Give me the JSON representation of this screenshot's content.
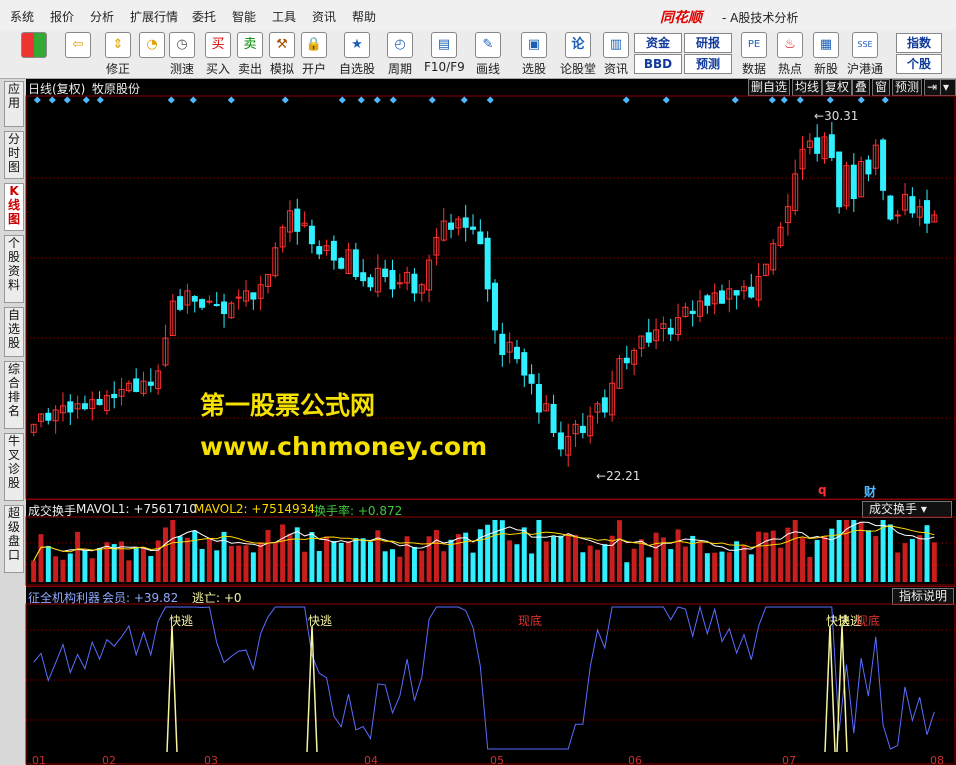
{
  "menubar": {
    "items": [
      "系统",
      "报价",
      "分析",
      "扩展行情",
      "委托",
      "智能",
      "工具",
      "资讯",
      "帮助"
    ],
    "brand": "同花顺",
    "brand_sub": "- A股技术分析"
  },
  "toolbar": {
    "buttons": [
      {
        "label": "",
        "icon": "home-icon"
      },
      {
        "label": "",
        "icon": "back-arrow-icon"
      },
      {
        "label": "修正",
        "icon": "up-down-arrow-icon"
      },
      {
        "label": "测速",
        "icon": "clock-icon"
      },
      {
        "label": "买入",
        "icon": "buy-icon"
      },
      {
        "label": "卖出",
        "icon": "sell-icon"
      },
      {
        "label": "模拟",
        "icon": "hammer-icon"
      },
      {
        "label": "开户",
        "icon": "lock-icon"
      },
      {
        "label": "自选股",
        "icon": "star-icon"
      },
      {
        "label": "周期",
        "icon": "period-icon"
      },
      {
        "label": "F10/F9",
        "icon": "f10-icon"
      },
      {
        "label": "画线",
        "icon": "pen-icon"
      },
      {
        "label": "选股",
        "icon": "select-icon"
      },
      {
        "label": "论股堂",
        "icon": "forum-icon"
      },
      {
        "label": "资讯",
        "icon": "news-icon"
      },
      {
        "label": "数据",
        "icon": "pe-icon"
      },
      {
        "label": "热点",
        "icon": "hot-icon"
      },
      {
        "label": "新股",
        "icon": "newstock-icon"
      },
      {
        "label": "沪港通",
        "icon": "sse-hk-icon"
      }
    ],
    "small_buttons": [
      "资金",
      "研报",
      "BBD",
      "预测",
      "指数",
      "个股"
    ]
  },
  "sidetabs": [
    "应用",
    "分时图",
    "K线图",
    "个股资料",
    "自选股",
    "综合排名",
    "牛叉诊股",
    "超级盘口"
  ],
  "active_tab": "K线图",
  "kline": {
    "title": "日线(复权)",
    "stock": "牧原股份",
    "toolbar_buttons": [
      "删自选",
      "均线",
      "复权",
      "叠",
      "窗",
      "预测"
    ],
    "high_label": "30.31",
    "low_label": "22.21",
    "markers": [
      "q",
      "财"
    ]
  },
  "volume": {
    "title": "成交换手",
    "mavol1": "MAVOL1: +7561710",
    "mavol2": "MAVOL2: +7514934",
    "turnover": "换手率: +0.872",
    "button": "成交换手"
  },
  "indicator": {
    "title": "征全机构利器",
    "member": "会员: +39.82",
    "escape": "逃亡: +0",
    "button": "指标说明",
    "labels": [
      {
        "text": "快逃",
        "color": "#f5f5a0"
      },
      {
        "text": "快逃",
        "color": "#f5f5a0"
      },
      {
        "text": "现底",
        "color": "#e03030"
      },
      {
        "text": "快逃",
        "color": "#f5f5a0"
      },
      {
        "text": "快逃",
        "color": "#f5f5a0"
      },
      {
        "text": "现底",
        "color": "#e03030"
      }
    ]
  },
  "watermark": {
    "line1": "第一股票公式网",
    "line2": "www.chnmoney.com"
  },
  "colors": {
    "up": "#ff3030",
    "down": "#30f0ff",
    "grid": "#8a0000",
    "diamond": "#4fb8ff",
    "ma": "#ffffff",
    "line": "#5a6dff",
    "spike": "#f5f5a0"
  },
  "chart_data": {
    "type": "candlestick",
    "x_ticks": [
      "01",
      "02",
      "03",
      "04",
      "05",
      "06",
      "07",
      "08"
    ],
    "price_range": [
      21.5,
      31
    ],
    "closes": [
      23.1,
      23.35,
      23.2,
      23.45,
      23.55,
      23.4,
      23.6,
      23.48,
      23.7,
      23.58,
      23.8,
      23.75,
      23.95,
      24.1,
      23.9,
      24.15,
      24.05,
      24.4,
      25.2,
      26.1,
      25.9,
      26.35,
      26.1,
      25.95,
      26.1,
      26.0,
      25.8,
      26.05,
      26.2,
      26.35,
      26.15,
      26.5,
      26.75,
      27.4,
      27.9,
      28.3,
      27.8,
      28.0,
      27.5,
      27.25,
      27.45,
      27.1,
      26.9,
      27.35,
      26.7,
      26.6,
      26.45,
      26.9,
      26.7,
      26.4,
      26.55,
      26.8,
      26.3,
      26.5,
      27.1,
      27.65,
      28.05,
      27.85,
      28.1,
      27.9,
      27.85,
      27.5,
      26.4,
      25.4,
      24.8,
      25.1,
      24.7,
      24.3,
      24.1,
      23.4,
      23.6,
      22.9,
      22.5,
      22.8,
      23.1,
      22.9,
      23.3,
      23.6,
      23.4,
      24.1,
      24.7,
      24.6,
      24.9,
      25.25,
      25.1,
      25.4,
      25.55,
      25.3,
      25.7,
      25.95,
      25.8,
      26.1,
      26.0,
      26.3,
      26.05,
      26.4,
      26.25,
      26.45,
      26.2,
      26.7,
      27.0,
      27.5,
      27.9,
      28.4,
      29.2,
      29.8,
      30.0,
      29.7,
      30.1,
      29.6,
      28.4,
      29.4,
      28.6,
      29.5,
      29.2,
      29.9,
      28.8,
      28.1,
      28.2,
      28.7,
      28.25,
      28.4,
      28.0,
      28.2
    ]
  }
}
